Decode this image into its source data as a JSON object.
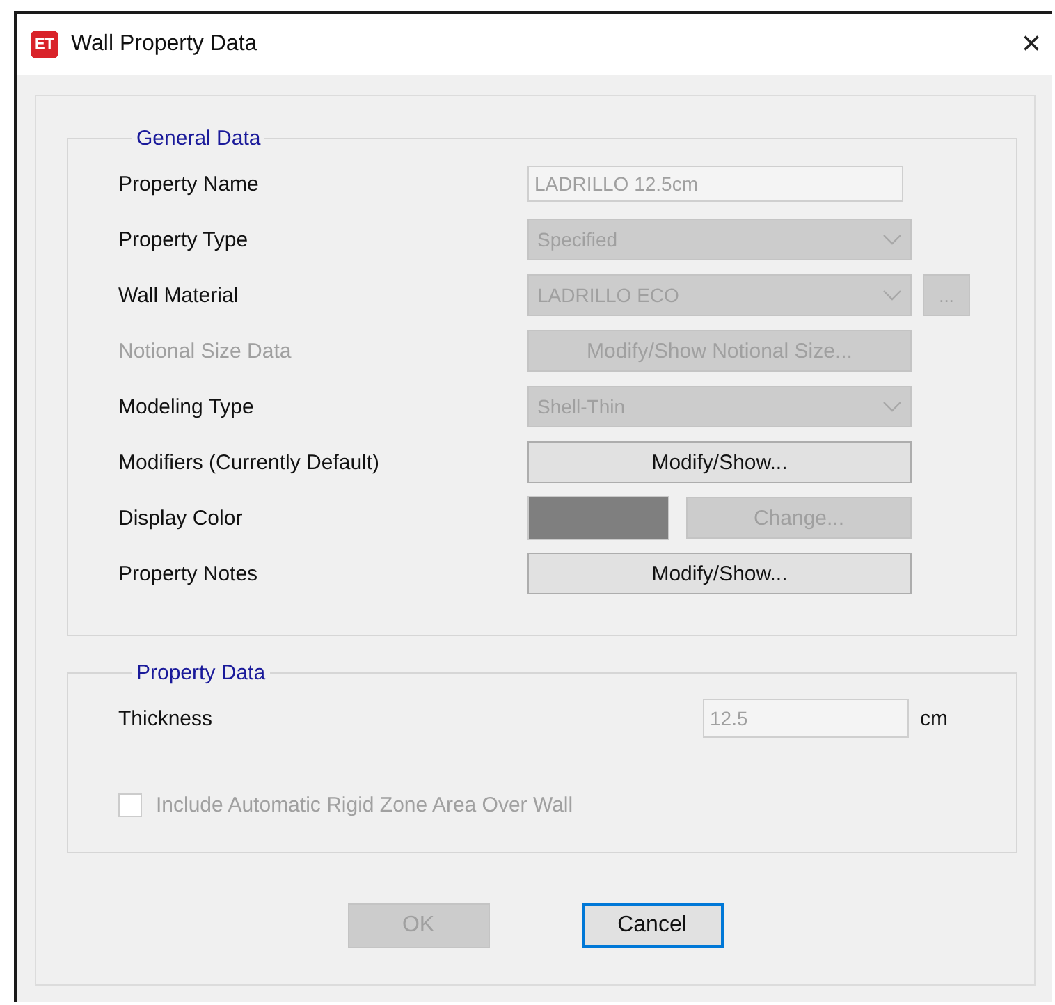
{
  "window": {
    "icon_text": "ET",
    "title": "Wall Property Data",
    "close": "×"
  },
  "general": {
    "title": "General Data",
    "rows": [
      {
        "label": "Property Name",
        "disabled": false,
        "control": {
          "kind": "text",
          "value": "LADRILLO 12.5cm",
          "disabled": true
        }
      },
      {
        "label": "Property Type",
        "disabled": false,
        "control": {
          "kind": "dropdown",
          "value": "Specified",
          "disabled": true
        }
      },
      {
        "label": "Wall Material",
        "disabled": false,
        "control": {
          "kind": "dropdown",
          "value": "LADRILLO ECO",
          "disabled": true
        },
        "extra": {
          "kind": "button",
          "label": "...",
          "disabled": true
        }
      },
      {
        "label": "Notional Size Data",
        "disabled": true,
        "control": {
          "kind": "button",
          "value": "Modify/Show Notional Size...",
          "disabled": true
        }
      },
      {
        "label": "Modeling Type",
        "disabled": false,
        "control": {
          "kind": "dropdown",
          "value": "Shell-Thin",
          "disabled": true
        }
      },
      {
        "label": "Modifiers (Currently Default)",
        "disabled": false,
        "control": {
          "kind": "button",
          "value": "Modify/Show...",
          "disabled": false
        }
      },
      {
        "label": "Display Color",
        "disabled": false,
        "control": {
          "kind": "swatch",
          "color": "#7f7f7f"
        },
        "extra": {
          "kind": "wide",
          "label": "Change...",
          "disabled": true
        }
      },
      {
        "label": "Property Notes",
        "disabled": false,
        "control": {
          "kind": "button",
          "value": "Modify/Show...",
          "disabled": false
        }
      }
    ]
  },
  "property": {
    "title": "Property Data",
    "thickness": {
      "label": "Thickness",
      "value": "12.5",
      "unit": "cm",
      "disabled": true
    },
    "checkbox": {
      "label": "Include Automatic Rigid Zone Area Over Wall",
      "checked": false,
      "disabled": true
    }
  },
  "buttons": [
    {
      "label": "OK",
      "disabled": true,
      "focused": false
    },
    {
      "label": "Cancel",
      "disabled": false,
      "focused": true
    }
  ]
}
